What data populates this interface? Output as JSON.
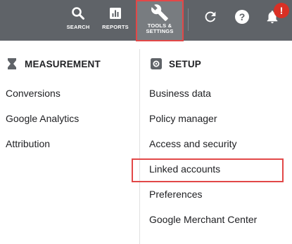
{
  "topbar": {
    "search_label": "SEARCH",
    "reports_label": "REPORTS",
    "tools_label_line1": "TOOLS &",
    "tools_label_line2": "SETTINGS",
    "notification_count": "!"
  },
  "measurement": {
    "title": "MEASUREMENT",
    "items": [
      "Conversions",
      "Google Analytics",
      "Attribution"
    ]
  },
  "setup": {
    "title": "SETUP",
    "items": [
      "Business data",
      "Policy manager",
      "Access and security",
      "Linked accounts",
      "Preferences",
      "Google Merchant Center"
    ]
  },
  "colors": {
    "topbar": "#5f6368",
    "highlight": "#e24848",
    "badge": "#d93025"
  }
}
